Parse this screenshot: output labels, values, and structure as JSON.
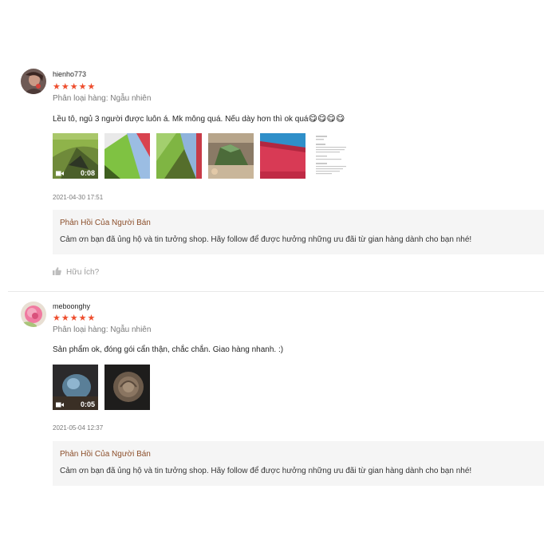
{
  "reviews": [
    {
      "username": "hienho773",
      "stars": "★★★★★",
      "variation": "Phân loại hàng: Ngẫu nhiên",
      "comment": "Lều tô, ngủ 3 người được luôn á. Mk mông quá. Nếu dày hơn thì ok quá",
      "emoji": "😋😋😋😋",
      "media": [
        {
          "kind": "video",
          "duration": "0:08"
        },
        {
          "kind": "image"
        },
        {
          "kind": "image"
        },
        {
          "kind": "image"
        },
        {
          "kind": "image"
        },
        {
          "kind": "image"
        }
      ],
      "timestamp": "2021-04-30 17:51",
      "reply_title": "Phản Hồi Của Người Bán",
      "reply_text": "Cảm ơn bạn đã ủng hộ và tin tưởng shop. Hãy follow để được hưởng những ưu đãi từ gian hàng dành cho bạn nhé!",
      "helpful": "Hữu Ích?"
    },
    {
      "username": "meboonghy",
      "stars": "★★★★★",
      "variation": "Phân loại hàng: Ngẫu nhiên",
      "comment": "Sản phẩm ok, đóng gói cẩn thận, chắc chắn. Giao hàng nhanh. :)",
      "media": [
        {
          "kind": "video",
          "duration": "0:05"
        },
        {
          "kind": "image"
        }
      ],
      "timestamp": "2021-05-04 12:37",
      "reply_title": "Phản Hồi Của Người Bán",
      "reply_text": "Cảm ơn bạn đã ủng hộ và tin tưởng shop. Hãy follow để được hưởng những ưu đãi từ gian hàng dành cho bạn nhé!"
    }
  ],
  "colors": {
    "star": "#ee4d2d",
    "reply_title": "#8b4e2a",
    "reply_bg": "#f5f5f5"
  }
}
